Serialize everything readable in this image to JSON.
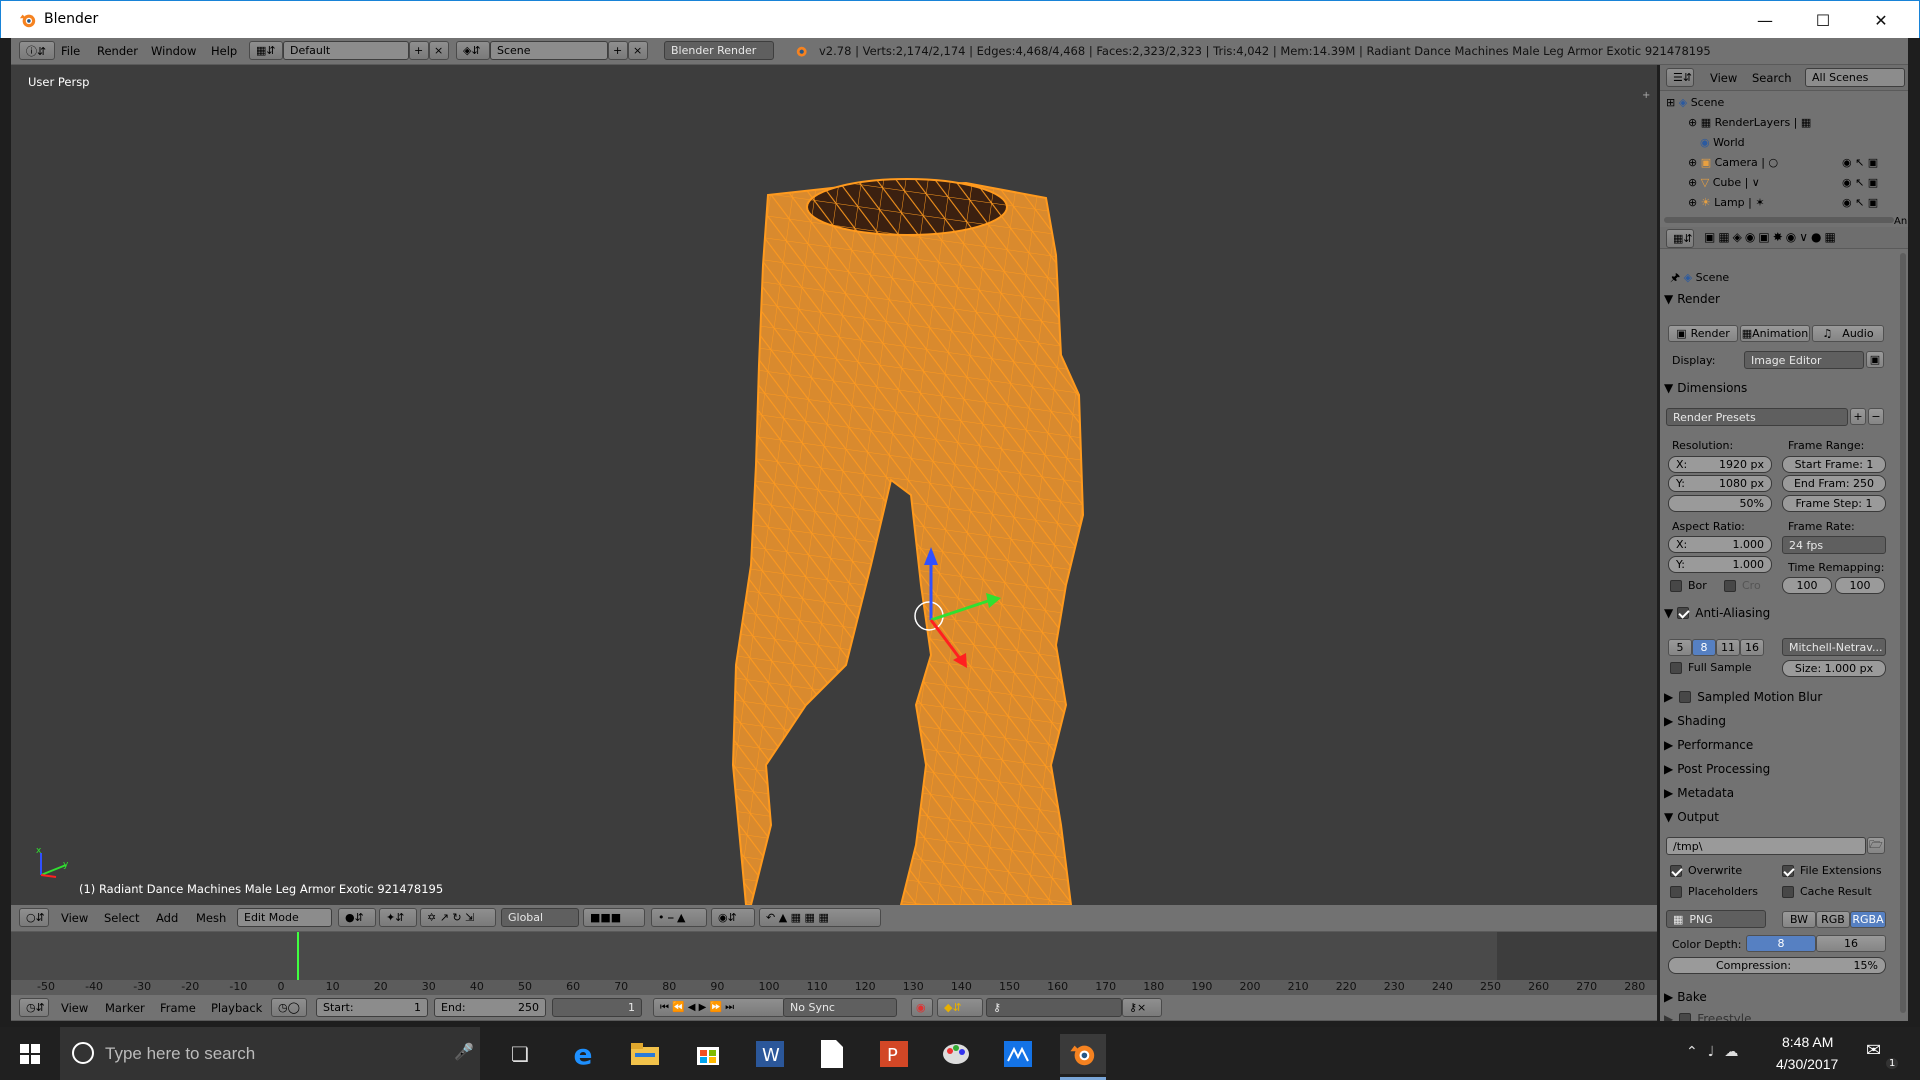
{
  "window": {
    "title": "Blender"
  },
  "topbar": {
    "menus": [
      "File",
      "Render",
      "Window",
      "Help"
    ],
    "layout": "Default",
    "scene": "Scene",
    "engine": "Blender Render",
    "stats": "v2.78 | Verts:2,174/2,174 | Edges:4,468/4,468 | Faces:2,323/2,323 | Tris:4,042 | Mem:14.39M | Radiant Dance Machines Male Leg Armor Exotic 921478195"
  },
  "viewport": {
    "persp_label": "User Persp",
    "object_label": "(1) Radiant Dance Machines Male Leg Armor Exotic 921478195",
    "axis_x": "x",
    "axis_y": "y"
  },
  "viewport_header": {
    "menus": [
      "View",
      "Select",
      "Add",
      "Mesh"
    ],
    "mode": "Edit Mode",
    "orientation": "Global"
  },
  "timeline": {
    "ruler": [
      "-50",
      "-40",
      "-30",
      "-20",
      "-10",
      "0",
      "10",
      "20",
      "30",
      "40",
      "50",
      "60",
      "70",
      "80",
      "90",
      "100",
      "110",
      "120",
      "130",
      "140",
      "150",
      "160",
      "170",
      "180",
      "190",
      "200",
      "210",
      "220",
      "230",
      "240",
      "250",
      "260",
      "270",
      "280"
    ],
    "menus": [
      "View",
      "Marker",
      "Frame",
      "Playback"
    ],
    "start_label": "Start:",
    "start_value": "1",
    "end_label": "End:",
    "end_value": "250",
    "current": "1",
    "sync": "No Sync"
  },
  "outliner": {
    "menus": [
      "View",
      "Search"
    ],
    "filter": "All Scenes",
    "items": [
      "Scene",
      "RenderLayers",
      "World",
      "Camera",
      "Cube",
      "Lamp"
    ],
    "cut": "An"
  },
  "properties": {
    "breadcrumb": "Scene",
    "render": {
      "title": "Render",
      "buttons": [
        "Render",
        "Animation",
        "Audio"
      ],
      "display_label": "Display:",
      "display_value": "Image Editor"
    },
    "dimensions": {
      "title": "Dimensions",
      "presets": "Render Presets",
      "resolution_label": "Resolution:",
      "res_x_label": "X:",
      "res_x": "1920 px",
      "res_y_label": "Y:",
      "res_y": "1080 px",
      "res_pct": "50%",
      "frame_range_label": "Frame Range:",
      "start_frame": "Start Frame: 1",
      "end_frame": "End Fram: 250",
      "frame_step": "Frame Step: 1",
      "aspect_label": "Aspect Ratio:",
      "asp_x": "1.000",
      "asp_y": "1.000",
      "frame_rate_label": "Frame Rate:",
      "fps": "24 fps",
      "time_remap_label": "Time Remapping:",
      "remap_old": "100",
      "remap_new": "100",
      "border": "Bor",
      "crop": "Cro"
    },
    "aa": {
      "title": "Anti-Aliasing",
      "samples": [
        "5",
        "8",
        "11",
        "16"
      ],
      "filter": "Mitchell-Netrav...",
      "full_sample": "Full Sample",
      "size": "Size: 1.000 px"
    },
    "collapsed": [
      "Sampled Motion Blur",
      "Shading",
      "Performance",
      "Post Processing",
      "Metadata"
    ],
    "output": {
      "title": "Output",
      "path": "/tmp\\",
      "overwrite": "Overwrite",
      "file_ext": "File Extensions",
      "placeholders": "Placeholders",
      "cache": "Cache Result",
      "format": "PNG",
      "modes": [
        "BW",
        "RGB",
        "RGBA"
      ],
      "depth_label": "Color Depth:",
      "depths": [
        "8",
        "16"
      ],
      "compression": "Compression:",
      "compression_value": "15%"
    },
    "bake": "Bake",
    "freestyle": "Freestyle"
  },
  "taskbar": {
    "search": "Type here to search",
    "time": "8:48 AM",
    "date": "4/30/2017",
    "notif": "1"
  },
  "colors": {
    "mesh": "#d98a2e",
    "wire": "#ff9a1e",
    "accent": "#5680c2"
  }
}
